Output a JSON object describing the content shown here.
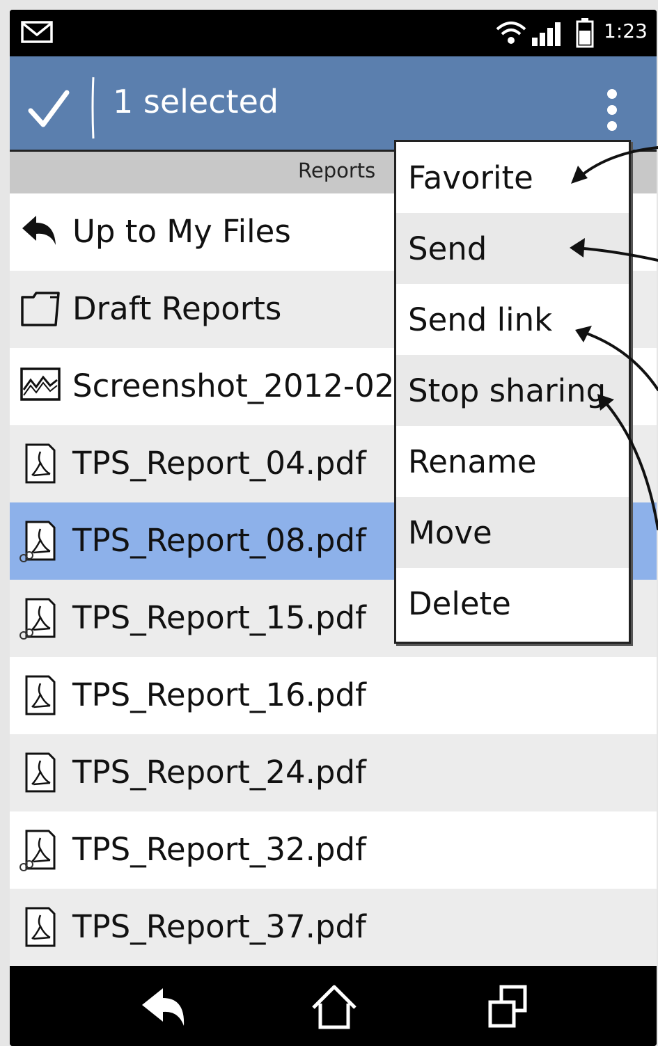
{
  "statusbar": {
    "time": "1:23",
    "icons": [
      "mail-icon",
      "wifi-icon",
      "signal-icon",
      "battery-icon"
    ]
  },
  "actionbar": {
    "done_icon": "checkmark-icon",
    "selected_text": "1 selected",
    "overflow_icon": "overflow-menu-icon",
    "color": "#5b7fae"
  },
  "subheader": {
    "label": "Reports"
  },
  "files": [
    {
      "label": "Up to My Files",
      "icon": "up-arrow-icon"
    },
    {
      "label": "Draft Reports",
      "icon": "folder-icon"
    },
    {
      "label": "Screenshot_2012-02-",
      "icon": "image-icon"
    },
    {
      "label": "TPS_Report_04.pdf",
      "icon": "pdf-icon"
    },
    {
      "label": "TPS_Report_08.pdf",
      "icon": "shared-pdf-icon",
      "selected": true
    },
    {
      "label": "TPS_Report_15.pdf",
      "icon": "shared-pdf-icon"
    },
    {
      "label": "TPS_Report_16.pdf",
      "icon": "pdf-icon"
    },
    {
      "label": "TPS_Report_24.pdf",
      "icon": "pdf-icon"
    },
    {
      "label": "TPS_Report_32.pdf",
      "icon": "shared-pdf-icon"
    },
    {
      "label": "TPS_Report_37.pdf",
      "icon": "pdf-icon"
    }
  ],
  "menu": {
    "items": [
      {
        "label": "Favorite"
      },
      {
        "label": "Send"
      },
      {
        "label": "Send link"
      },
      {
        "label": "Stop sharing"
      },
      {
        "label": "Rename"
      },
      {
        "label": "Move"
      },
      {
        "label": "Delete"
      }
    ]
  },
  "navbar": {
    "icons": [
      "back-icon",
      "home-icon",
      "recent-apps-icon"
    ]
  },
  "colors": {
    "selected_row": "#8db1ea",
    "row_alt": "#ececec",
    "menu_alt": "#e9e9e9"
  }
}
